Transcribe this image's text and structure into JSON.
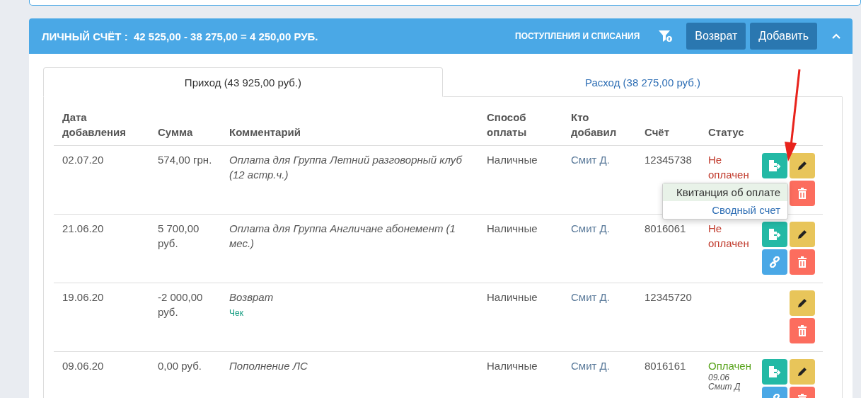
{
  "panel": {
    "title": "ЛИЧНЫЙ СЧЁТ :  42 525,00 - 38 275,00 = 4 250,00 РУБ.",
    "link": "ПОСТУПЛЕНИЯ И СПИСАНИЯ",
    "buttons": [
      "Возврат",
      "Добавить"
    ]
  },
  "tabs": [
    {
      "label": "Приход (43 925,00 руб.)",
      "selected": true
    },
    {
      "label": "Расход (38 275,00 руб.)",
      "selected": false
    }
  ],
  "table": {
    "columns": [
      "Дата добавления",
      "Сумма",
      "Комментарий",
      "Способ оплаты",
      "Кто добавил",
      "Счёт",
      "Статус"
    ],
    "rows": [
      {
        "date": "02.07.20",
        "amount": "574,00 грн.",
        "comment": "Оплата для Группа Летний разговорный клуб (12 астр.ч.)",
        "method": "Наличные",
        "added_by": "Смит Д.",
        "account": "12345738",
        "status": {
          "kind": "unpaid",
          "text": "Не оплачен"
        },
        "actions": [
          {
            "kind": "receipt"
          },
          {
            "kind": "edit"
          },
          {
            "kind": "delete"
          }
        ],
        "menu": [
          {
            "label": "Квитанция об оплате",
            "selected": true
          },
          {
            "label": "Сводный счет",
            "selected": false
          }
        ]
      },
      {
        "date": "21.06.20",
        "amount": "5 700,00 руб.",
        "comment": "Оплата для Группа Англичане абонемент (1 мес.)",
        "method": "Наличные",
        "added_by": "Смит Д.",
        "account": "8016061",
        "status": {
          "kind": "unpaid",
          "text": "Не оплачен"
        },
        "actions": [
          {
            "kind": "receipt"
          },
          {
            "kind": "edit"
          },
          {
            "kind": "link"
          },
          {
            "kind": "delete"
          }
        ]
      },
      {
        "date": "19.06.20",
        "amount": "-2 000,00 руб.",
        "comment": "Возврат",
        "note": "Чек",
        "method": "Наличные",
        "added_by": "Смит Д.",
        "account": "12345720",
        "actions": [
          {
            "kind": "edit"
          },
          {
            "kind": "delete"
          }
        ]
      },
      {
        "date": "09.06.20",
        "amount": "0,00 руб.",
        "comment": "Пополнение ЛС",
        "method": "Наличные",
        "added_by": "Смит Д.",
        "account": "8016161",
        "status": {
          "kind": "paid",
          "text": "Оплачен",
          "date": "09.06",
          "by": "Смит Д"
        },
        "actions": [
          {
            "kind": "receipt"
          },
          {
            "kind": "edit"
          },
          {
            "kind": "link"
          },
          {
            "kind": "delete"
          }
        ]
      }
    ]
  }
}
